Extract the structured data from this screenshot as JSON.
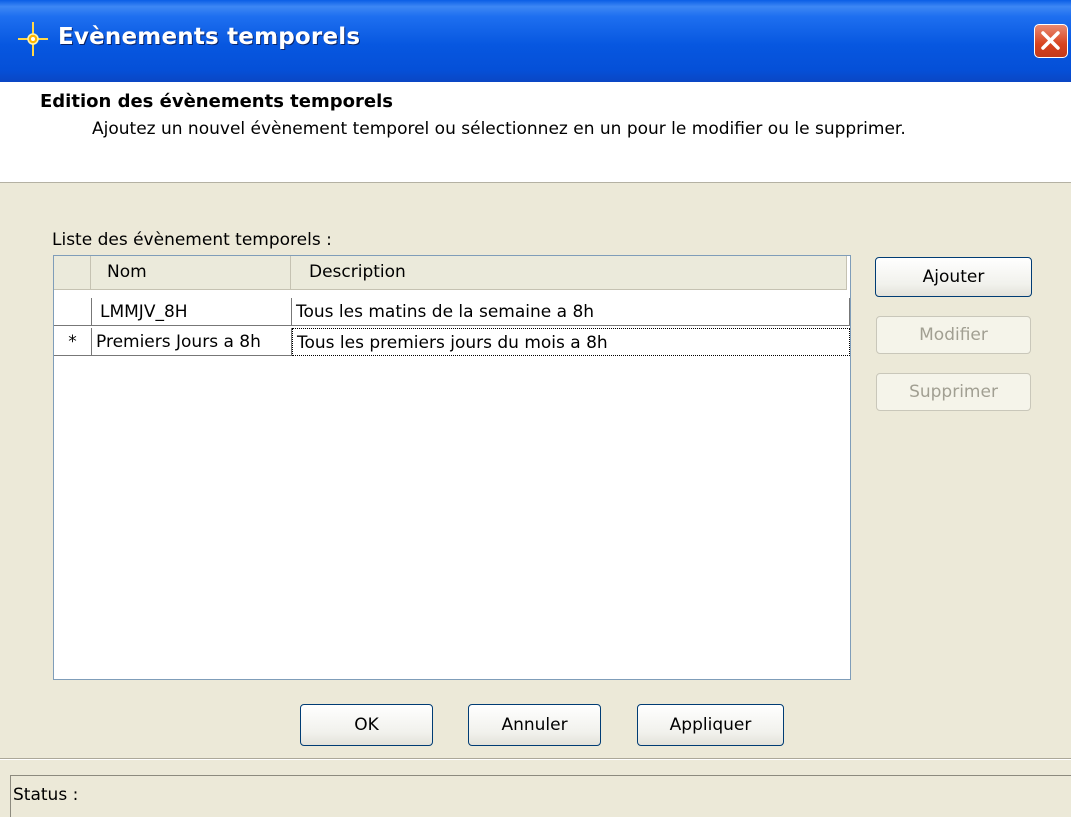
{
  "window": {
    "title": "Evènements temporels",
    "icon": "sparkle-icon",
    "close_icon": "close-icon"
  },
  "header": {
    "title": "Edition des évènements temporels",
    "description": "Ajoutez un nouvel évènement temporel ou sélectionnez en un pour le modifier ou le supprimer."
  },
  "list": {
    "label": "Liste des évènement temporels :",
    "columns": [
      "",
      "Nom",
      "Description"
    ],
    "rows": [
      {
        "marker": "",
        "name": "LMMJV_8H",
        "description": "Tous les matins de la semaine a 8h"
      },
      {
        "marker": "*",
        "name": "Premiers Jours a 8h",
        "description": "Tous les premiers jours du mois a 8h"
      }
    ]
  },
  "side_buttons": {
    "add": "Ajouter",
    "modify": "Modifier",
    "delete": "Supprimer"
  },
  "bottom_buttons": {
    "ok": "OK",
    "cancel": "Annuler",
    "apply": "Appliquer"
  },
  "status": {
    "label": "Status :"
  },
  "colors": {
    "titlebar": "#0757e0",
    "window_background": "#ece9d8",
    "close_button": "#d8431f"
  }
}
